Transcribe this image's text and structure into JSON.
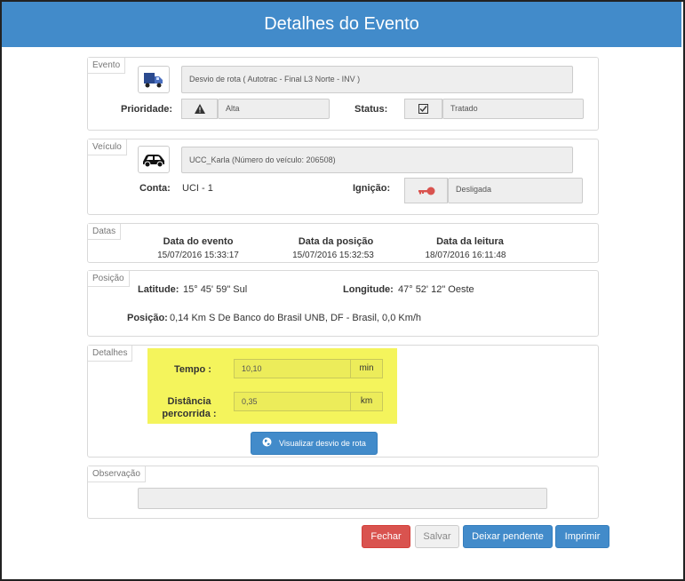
{
  "title": "Detalhes do Evento",
  "evento": {
    "legend": "Evento",
    "icon": "truck-icon",
    "description": "Desvio de rota ( Autotrac - Final L3 Norte - INV )",
    "prioridade_label": "Prioridade:",
    "prioridade_value": "Alta",
    "status_label": "Status:",
    "status_value": "Tratado"
  },
  "veiculo": {
    "legend": "Veículo",
    "icon": "car-icon",
    "name": "UCC_Karla (Número do veículo: 206508)",
    "conta_label": "Conta:",
    "conta_value": "UCI - 1",
    "ignicao_label": "Ignição:",
    "ignicao_value": "Desligada",
    "ignicao_color": "#d9534f"
  },
  "datas": {
    "legend": "Datas",
    "evento_label": "Data do evento",
    "evento_value": "15/07/2016 15:33:17",
    "posicao_label": "Data da posição",
    "posicao_value": "15/07/2016 15:32:53",
    "leitura_label": "Data da leitura",
    "leitura_value": "18/07/2016 16:11:48"
  },
  "posicao": {
    "legend": "Posição",
    "latitude_label": "Latitude:",
    "latitude_value": "15° 45' 59\" Sul",
    "longitude_label": "Longitude:",
    "longitude_value": "47° 52' 12\" Oeste",
    "posicao_label": "Posição:",
    "posicao_value": "0,14 Km S De Banco do Brasil UNB, DF - Brasil, 0,0 Km/h"
  },
  "detalhes": {
    "legend": "Detalhes",
    "tempo_label": "Tempo :",
    "tempo_value": "10,10",
    "tempo_unit": "min",
    "distancia_label_1": "Distância",
    "distancia_label_2": "percorrida :",
    "distancia_value": "0,35",
    "distancia_unit": "km",
    "highlight_color": "#f4f45c",
    "visualizar_button": "Visualizar desvio de rota"
  },
  "observacao": {
    "legend": "Observação",
    "value": ""
  },
  "buttons": {
    "fechar": "Fechar",
    "salvar": "Salvar",
    "deixar_pendente": "Deixar pendente",
    "imprimir": "Imprimir"
  },
  "colors": {
    "primary": "#428bca",
    "danger": "#d9534f"
  }
}
